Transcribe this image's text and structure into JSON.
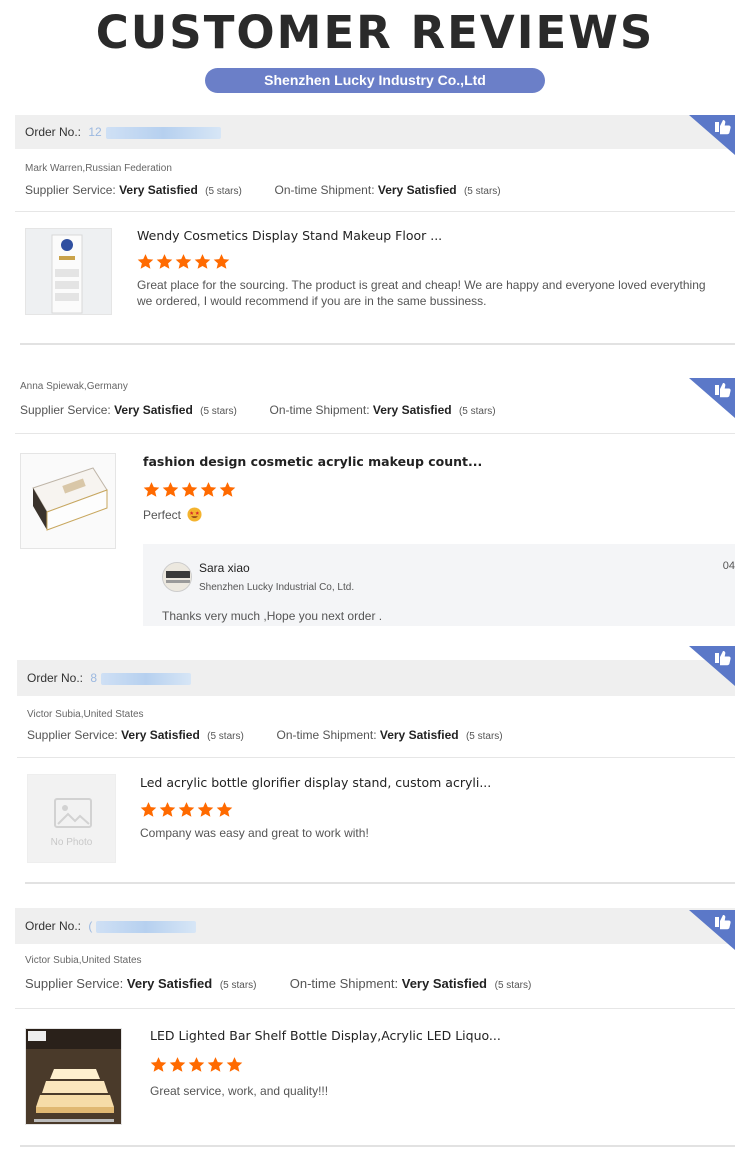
{
  "header": {
    "title": "CUSTOMER REVIEWS",
    "company": "Shenzhen Lucky Industry Co.,Ltd"
  },
  "labels": {
    "order_no": "Order No.:",
    "supplier_service": "Supplier Service:",
    "ontime_shipment": "On-time Shipment:"
  },
  "reviews": [
    {
      "order_no_visible": "12",
      "reviewer": "Mark Warren,Russian Federation",
      "supplier_rating": "Very Satisfied",
      "supplier_stars": "(5 stars)",
      "shipment_rating": "Very Satisfied",
      "shipment_stars": "(5 stars)",
      "product_title": "Wendy Cosmetics Display Stand Makeup Floor ...",
      "stars": 5,
      "text": "Great place for the sourcing. The product is great and cheap! We are happy and everyone loved everything we ordered, I would recommend if you are in the same bussiness."
    },
    {
      "reviewer": "Anna Spiewak,Germany",
      "supplier_rating": "Very Satisfied",
      "supplier_stars": "(5 stars)",
      "shipment_rating": "Very Satisfied",
      "shipment_stars": "(5 stars)",
      "product_title": "fashion design cosmetic acrylic makeup count...",
      "stars": 5,
      "text": "Perfect",
      "emoji": "star-struck-emoji",
      "reply": {
        "name": "Sara xiao",
        "company": "Shenzhen Lucky Industrial Co, Ltd.",
        "date": "04",
        "text": "Thanks very much ,Hope you next order ."
      }
    },
    {
      "order_no_visible": "8",
      "reviewer": "Victor Subia,United States",
      "supplier_rating": "Very Satisfied",
      "supplier_stars": "(5 stars)",
      "shipment_rating": "Very Satisfied",
      "shipment_stars": "(5 stars)",
      "product_title": "Led acrylic bottle glorifier display stand, custom acryli...",
      "stars": 5,
      "no_photo": "No Photo",
      "text": "Company was easy and great to work with!"
    },
    {
      "order_no_visible": "(",
      "reviewer": "Victor Subia,United States",
      "supplier_rating": "Very Satisfied",
      "supplier_stars": "(5 stars)",
      "shipment_rating": "Very Satisfied",
      "shipment_stars": "(5 stars)",
      "product_title": "LED Lighted Bar Shelf Bottle Display,Acrylic LED Liquo...",
      "stars": 5,
      "text": "Great service, work, and quality!!!"
    }
  ],
  "colors": {
    "accent": "#6b7fc8",
    "star": "#ff6a00",
    "badge": "#5b78c8"
  }
}
